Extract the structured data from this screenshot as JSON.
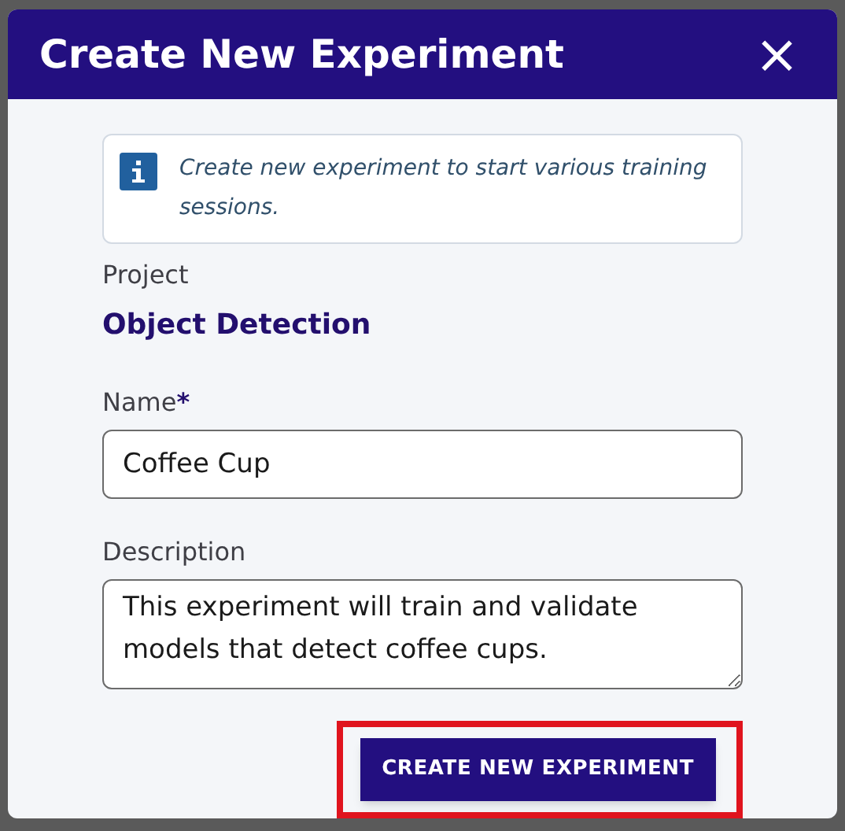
{
  "dialog": {
    "title": "Create New Experiment",
    "close": "×",
    "info": "Create new experiment to start various training sessions.",
    "project": {
      "label": "Project",
      "value": "Object Detection"
    },
    "fields": [
      {
        "kind": "input",
        "label": "Name",
        "required_mark": "*",
        "value": "Coffee Cup"
      },
      {
        "kind": "textarea",
        "label": "Description",
        "value": "This experiment will train and validate models that detect coffee cups."
      }
    ],
    "button": {
      "label": "CREATE NEW EXPERIMENT",
      "highlighted": true
    }
  }
}
